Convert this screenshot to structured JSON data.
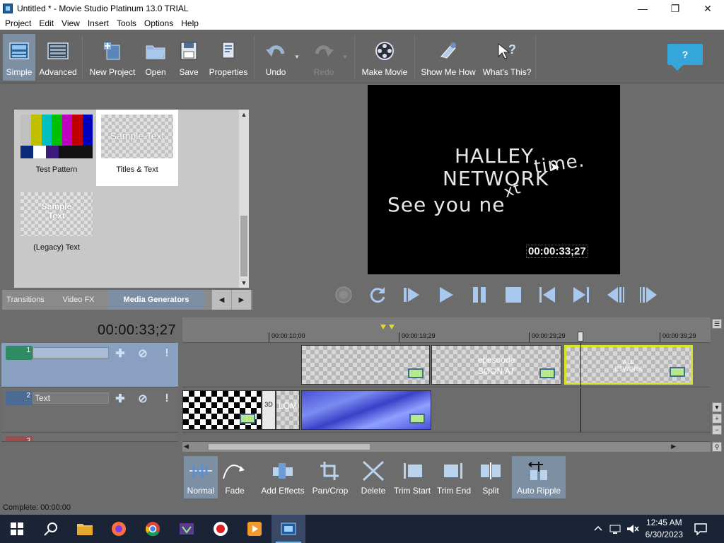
{
  "window": {
    "title": "Untitled * - Movie Studio Platinum 13.0 TRIAL"
  },
  "menu": [
    "Project",
    "Edit",
    "View",
    "Insert",
    "Tools",
    "Options",
    "Help"
  ],
  "toolbar": {
    "simple": "Simple",
    "advanced": "Advanced",
    "new_project": "New Project",
    "open": "Open",
    "save": "Save",
    "properties": "Properties",
    "undo": "Undo",
    "redo": "Redo",
    "make_movie": "Make Movie",
    "show_me_how": "Show Me How",
    "whats_this": "What's This?",
    "help": "?"
  },
  "media_generators": {
    "items": [
      {
        "label": "Test Pattern",
        "icon": "test-pattern"
      },
      {
        "label": "Titles & Text",
        "thumb_text": "Sample Text",
        "selected": true
      },
      {
        "label": "(Legacy) Text",
        "thumb_text": "Sample\nText"
      }
    ],
    "tabs": [
      "Transitions",
      "Video FX",
      "Media Generators"
    ],
    "active_tab": "Media Generators"
  },
  "preview": {
    "line1": "HALLEY",
    "line2": "NETWORK",
    "line3": "See you ne",
    "line3b": "xt",
    "line4": "time.",
    "timecode": "00:00:33;27"
  },
  "timeline": {
    "timecode": "00:00:33;27",
    "ruler_marks": [
      "00:00:10;00",
      "00:00:19;29",
      "00:00:29;29",
      "00:00:39;29"
    ],
    "tracks": [
      {
        "number": "1",
        "name": "",
        "color": "#2e8b63"
      },
      {
        "number": "2",
        "name": "Text",
        "color": "#4b6b94"
      },
      {
        "number": "3",
        "name": "",
        "color": "#a04b4b"
      }
    ],
    "track1_clips": [
      {
        "text": ""
      },
      {
        "text": "epesoode\nSOON AT"
      },
      {
        "text": "ALL\nETWORK"
      }
    ],
    "track2_clips": [
      {
        "text": ""
      },
      {
        "text": "3D"
      },
      {
        "text": "LOM"
      },
      {
        "text": ""
      }
    ]
  },
  "bottom_tools": {
    "normal": "Normal",
    "fade": "Fade",
    "add_effects": "Add Effects",
    "pan_crop": "Pan/Crop",
    "delete": "Delete",
    "trim_start": "Trim Start",
    "trim_end": "Trim End",
    "split": "Split",
    "auto_ripple": "Auto Ripple"
  },
  "status": {
    "text": "Complete: 00:00:00"
  },
  "taskbar": {
    "time": "12:45 AM",
    "date": "6/30/2023"
  },
  "colors": {
    "accent": "#35a6d9",
    "selected": "#7d8fa3",
    "track_selected": "#8aa0c0",
    "clip_highlight": "#d8e62a"
  }
}
